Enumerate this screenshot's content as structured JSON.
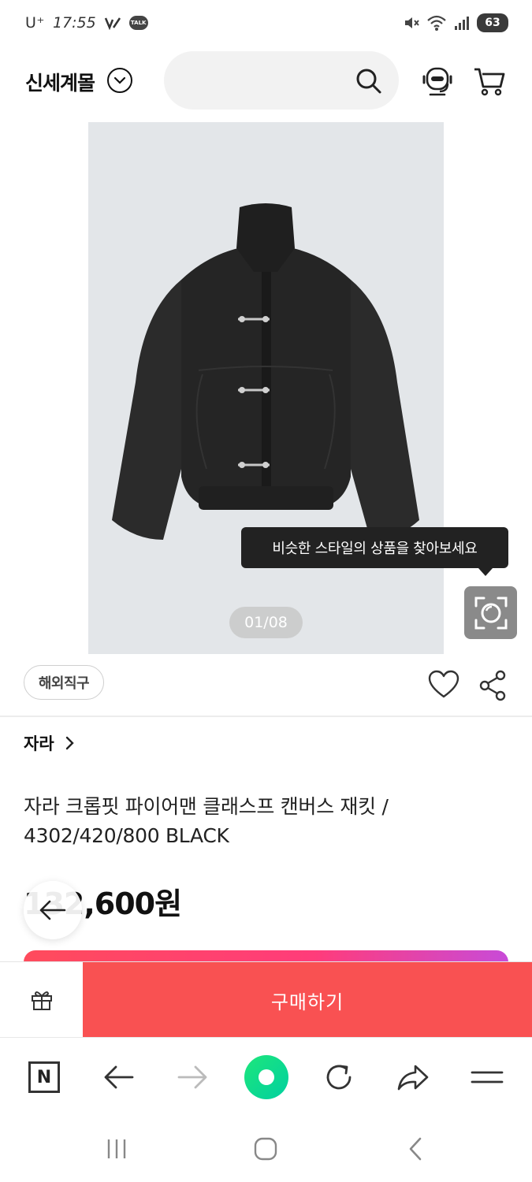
{
  "status_bar": {
    "carrier": "U⁺",
    "time": "17:55",
    "talk_badge": "TALK",
    "battery": "63"
  },
  "header": {
    "logo": "신세계몰",
    "search": {
      "value": "",
      "placeholder": ""
    }
  },
  "gallery": {
    "page_indicator": "01/08",
    "tooltip": "비슷한 스타일의 상품을 찾아보세요"
  },
  "product": {
    "badge": "해외직구",
    "brand": "자라",
    "title": "자라 크롭핏 파이어맨 클래스프 캔버스 재킷 / 4302/420/800 BLACK",
    "price": "132,600원"
  },
  "buy_bar": {
    "buy_label": "구매하기"
  },
  "browser_bar": {
    "n_label": "N"
  },
  "colors": {
    "buy_button": "#f95152",
    "promo_gradient_start": "#ff4b5c",
    "promo_gradient_end": "#c84bd8",
    "green_button": "#1ee67b",
    "image_bg": "#e3e6e9"
  },
  "icons": [
    "chevron-down-icon",
    "search-icon",
    "chat-agent-icon",
    "cart-icon",
    "back-arrow-icon",
    "lens-search-icon",
    "heart-icon",
    "share-icon",
    "chevron-right-icon",
    "gift-icon",
    "n-home-icon",
    "forward-icon",
    "refresh-icon",
    "share-arrow-icon",
    "menu-icon",
    "recent-apps-icon",
    "home-icon",
    "back-icon"
  ]
}
